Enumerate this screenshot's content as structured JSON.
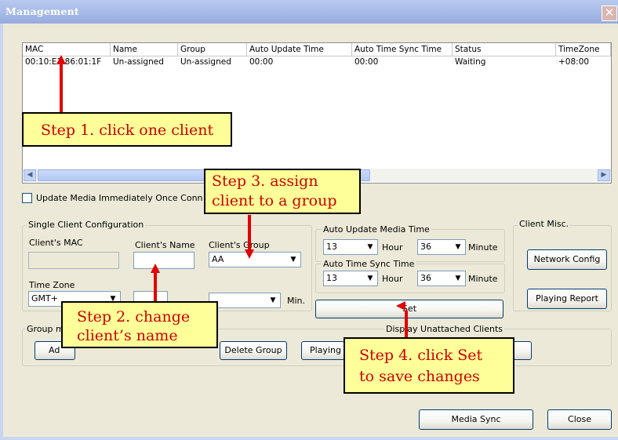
{
  "window": {
    "title": "Management",
    "close_glyph": "✕"
  },
  "table": {
    "columns": [
      "MAC",
      "Name",
      "Group",
      "Auto Update Time",
      "Auto Time Sync Time",
      "Status",
      "TimeZone"
    ],
    "rows": [
      [
        "00:10:E1:86:01:1F",
        "Un-assigned",
        "Un-assigned",
        "00:00",
        "00:00",
        "Waiting",
        "+08:00"
      ]
    ]
  },
  "update_media": {
    "label": "Update Media Immediately Once Conn",
    "checked": false
  },
  "single_client": {
    "group_label": "Single Client Configuration",
    "mac_label": "Client's MAC",
    "mac_value": "",
    "name_label": "Client's Name",
    "name_value": "",
    "group_field_label": "Client's Group",
    "group_value": "AA",
    "tz_label": "Time Zone",
    "tz_value": "GMT+",
    "tz_min_label": "Min."
  },
  "auto_update": {
    "label": "Auto Update Media Time",
    "hour": "13",
    "hour_label": "Hour",
    "minute": "36",
    "minute_label": "Minute"
  },
  "auto_sync": {
    "label": "Auto Time Sync Time",
    "hour": "13",
    "hour_label": "Hour",
    "minute": "36",
    "minute_label": "Minute"
  },
  "set_button": "Set",
  "client_misc": {
    "label": "Client Misc.",
    "network_config": "Network Config",
    "playing_report": "Playing Report"
  },
  "group_mgmt": {
    "label": "Group m",
    "add_label": "Ad",
    "delete_label": "Delete Group",
    "playing_label": "Playing"
  },
  "display_unattached": "Display Unattached Clients",
  "bottom": {
    "media_sync": "Media Sync",
    "close": "Close"
  },
  "notes": {
    "step1": "Step 1. click one client",
    "step2_line1": "Step 2. change",
    "step2_line2": "client’s name",
    "step3_line1": "Step 3. assign",
    "step3_line2": "client to a group",
    "step4_line1": "Step 4. click Set",
    "step4_line2": "to save changes"
  },
  "colors": {
    "annotation_red": "#cc0000",
    "note_bg": "#ffff99",
    "dialog_bg": "#ece9d8"
  }
}
